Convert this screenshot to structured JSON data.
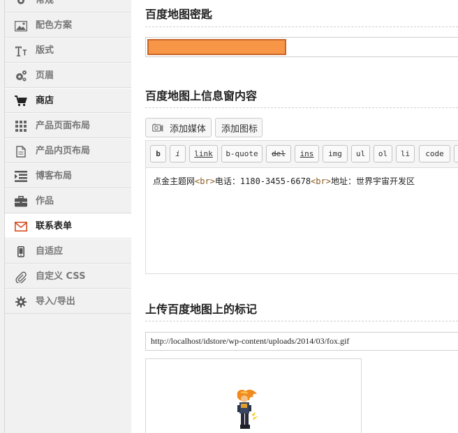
{
  "sidebar": {
    "items": [
      {
        "label": "常规",
        "icon": "gear-icon"
      },
      {
        "label": "配色方案",
        "icon": "image-icon"
      },
      {
        "label": "版式",
        "icon": "typography-icon"
      },
      {
        "label": "页眉",
        "icon": "gears-icon"
      },
      {
        "label": "商店",
        "icon": "cart-icon"
      },
      {
        "label": "产品页面布局",
        "icon": "grid-icon"
      },
      {
        "label": "产品内页布局",
        "icon": "document-icon"
      },
      {
        "label": "博客布局",
        "icon": "list-indent-icon"
      },
      {
        "label": "作品",
        "icon": "briefcase-icon"
      },
      {
        "label": "联系表单",
        "icon": "envelope-icon"
      },
      {
        "label": "自适应",
        "icon": "mobile-icon"
      },
      {
        "label": "自定义 CSS",
        "icon": "paperclip-icon"
      },
      {
        "label": "导入/导出",
        "icon": "gear-icon"
      }
    ]
  },
  "main": {
    "map_key_title": "百度地图密匙",
    "info_title": "百度地图上信息窗内容",
    "add_media_label": "添加媒体",
    "add_icon_label": "添加图标",
    "quicktags": [
      "b",
      "i",
      "link",
      "b-quote",
      "del",
      "ins",
      "img",
      "ul",
      "ol",
      "li",
      "code"
    ],
    "editor": {
      "seg1": "点金主题网",
      "tag1": "<br>",
      "seg2": "电话：1180-3455-6678",
      "tag2": "<br>",
      "seg3": "地址：世界宇宙开发区"
    },
    "marker_title": "上传百度地图上的标记",
    "marker_url": "http://localhost/idstore/wp-content/uploads/2014/03/fox.gif"
  },
  "colors": {
    "redacted": "#f79646",
    "accent": "#d54e21"
  }
}
